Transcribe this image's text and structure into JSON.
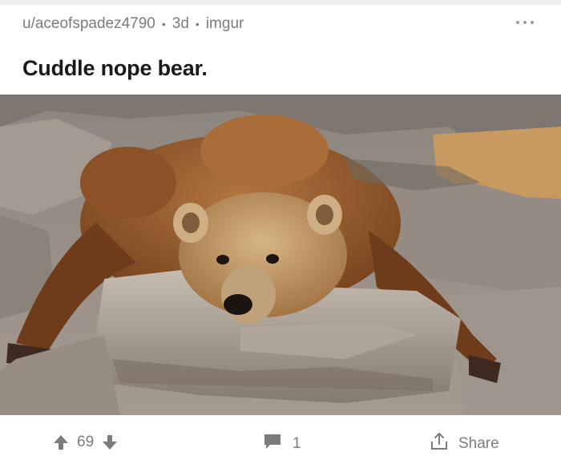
{
  "post": {
    "username": "u/aceofspadez4790",
    "age": "3d",
    "source": "imgur",
    "title": "Cuddle nope bear."
  },
  "image": {
    "subject": "brown bear lying sprawled on a rock",
    "colors": {
      "rock": "#a49a90",
      "fur": "#9b5e2e",
      "fur_light": "#c8a070",
      "shadow": "#5a4a3c"
    }
  },
  "actions": {
    "upvote_icon": "arrow-up-icon",
    "score": "69",
    "downvote_icon": "arrow-down-icon",
    "comment_icon": "comment-bubble-icon",
    "comment_count": "1",
    "share_icon": "share-upload-icon",
    "share_label": "Share"
  },
  "menu_icon": "more-horizontal-icon",
  "colors": {
    "text_secondary": "#7c7c7c",
    "text_primary": "#1a1a1b",
    "divider": "#ecedef",
    "icon": "#7c7c7c"
  }
}
